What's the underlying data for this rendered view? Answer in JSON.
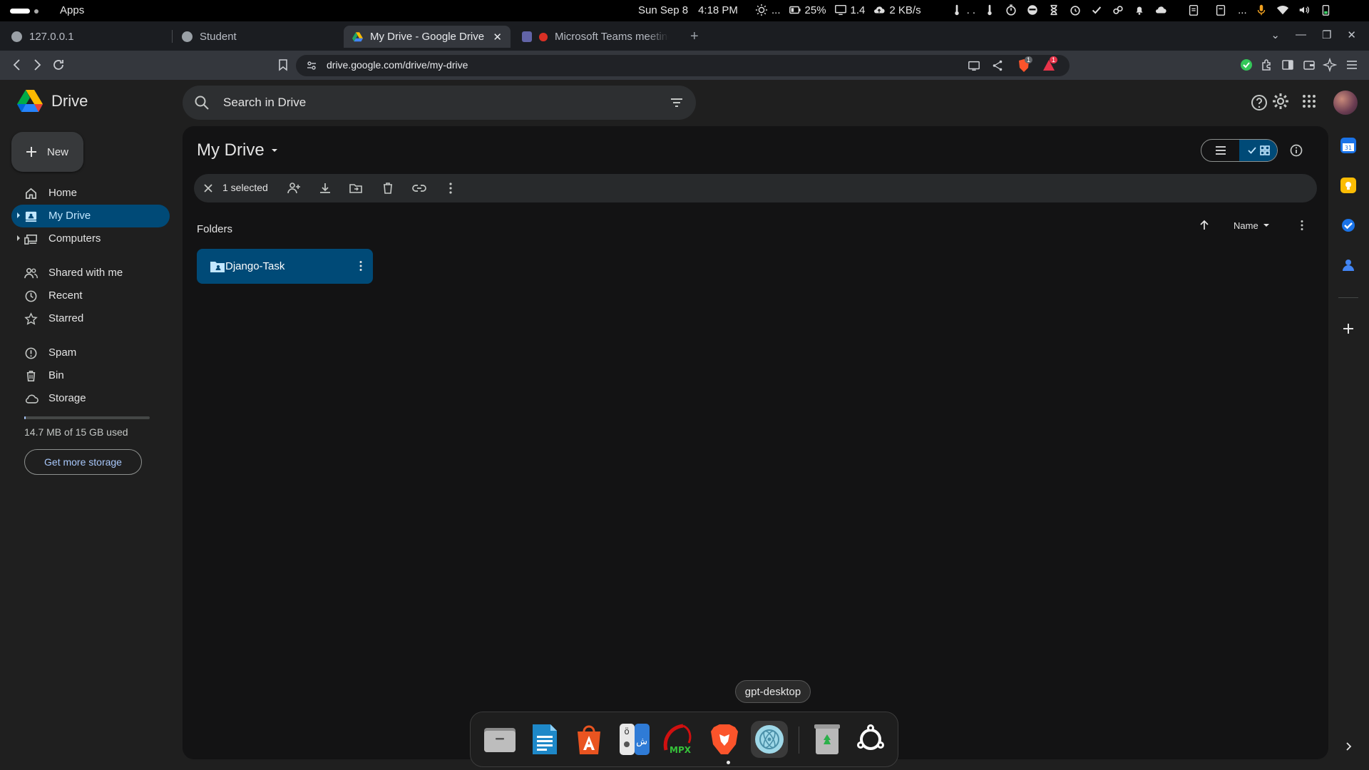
{
  "system_bar": {
    "apps_label": "Apps",
    "date": "Sun Sep 8",
    "time": "4:18 PM",
    "weather_suffix": "...",
    "battery": "25%",
    "load": "1.4",
    "net_speed": "2 KB/s",
    "tray_dots": ". ."
  },
  "browser": {
    "tabs": [
      {
        "title": "127.0.0.1",
        "active": false
      },
      {
        "title": "Student",
        "active": false
      },
      {
        "title": "My Drive - Google Drive",
        "active": true
      },
      {
        "title": "Microsoft Teams meeting",
        "active": false
      }
    ],
    "new_tab_label": "+",
    "url": "drive.google.com/drive/my-drive",
    "brave_badge": "1",
    "alert_badge": "1"
  },
  "drive": {
    "app_name": "Drive",
    "search_placeholder": "Search in Drive",
    "new_button": "New",
    "nav": [
      {
        "label": "Home",
        "icon": "home-icon"
      },
      {
        "label": "My Drive",
        "icon": "my-drive-icon",
        "active": true,
        "expandable": true
      },
      {
        "label": "Computers",
        "icon": "computers-icon",
        "expandable": true
      },
      {
        "label": "Shared with me",
        "icon": "shared-icon"
      },
      {
        "label": "Recent",
        "icon": "clock-icon"
      },
      {
        "label": "Starred",
        "icon": "star-icon"
      },
      {
        "label": "Spam",
        "icon": "spam-icon"
      },
      {
        "label": "Bin",
        "icon": "bin-icon"
      },
      {
        "label": "Storage",
        "icon": "cloud-icon"
      }
    ],
    "storage": {
      "used_text": "14.7 MB of 15 GB used",
      "used_fraction": 0.001,
      "button": "Get more storage"
    },
    "main": {
      "title": "My Drive",
      "selection_text": "1 selected",
      "folders_heading": "Folders",
      "sort_label": "Name",
      "folders": [
        {
          "name": "Django-Task",
          "selected": true
        }
      ]
    }
  },
  "dock": {
    "tooltip": "gpt-desktop",
    "apps": [
      "files",
      "writer",
      "app-center",
      "keyboard",
      "mpx",
      "brave",
      "gpt-desktop",
      "trash",
      "ubuntu"
    ]
  },
  "colors": {
    "accent": "#004a77",
    "accent_text": "#c2e7ff",
    "background": "#1f1f1f",
    "panel": "#131314"
  }
}
